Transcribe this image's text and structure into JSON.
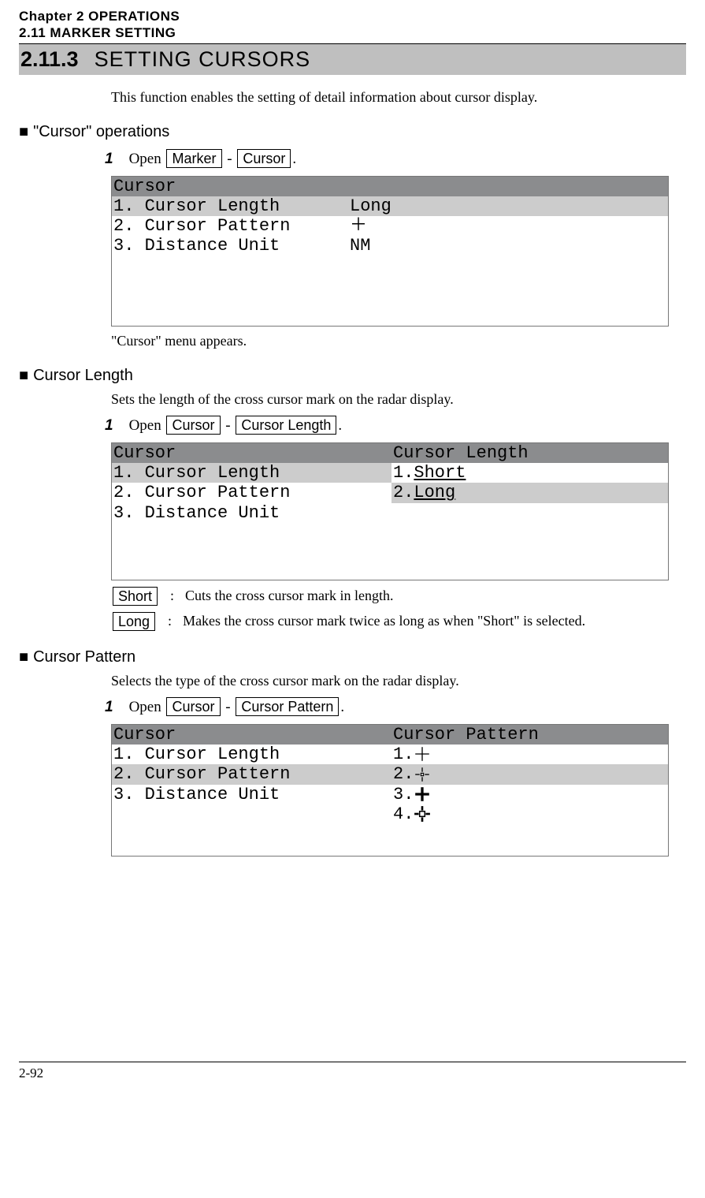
{
  "header": {
    "chapter": "Chapter  2    OPERATIONS",
    "section": "2.11    MARKER  SETTING"
  },
  "section_title": {
    "number": "2.11.3",
    "label": "SETTING CURSORS"
  },
  "intro": "This function enables the setting of detail information about cursor display.",
  "ops": {
    "heading": "\"Cursor\" operations",
    "step_open": "Open",
    "step_num": "1",
    "btn_marker": "Marker",
    "btn_cursor": "Cursor",
    "period": ".",
    "dash": " - ",
    "menu": {
      "title": "Cursor",
      "row1_label": "1.  Cursor Length",
      "row1_value": "Long",
      "row2_label": "2.  Cursor Pattern",
      "row2_value": "＋",
      "row3_label": "3.  Distance Unit",
      "row3_value": "NM"
    },
    "appears": "\"Cursor\" menu appears."
  },
  "clen": {
    "heading": "Cursor Length",
    "desc": "Sets the length of the cross cursor mark on the radar display.",
    "step_num": "1",
    "step_open": "Open",
    "btn_cursor": "Cursor",
    "btn_cursor_length": "Cursor Length",
    "period": ".",
    "dash": " - ",
    "menu": {
      "left_title": "Cursor",
      "right_title": "Cursor Length",
      "left_row1": "1.  Cursor Length",
      "left_row2": "2.  Cursor Pattern",
      "left_row3": "3.  Distance Unit",
      "right_row1_num": "1.",
      "right_row1_val": "Short",
      "right_row2_num": "2.",
      "right_row2_val": "Long"
    },
    "opt_short": "Short",
    "opt_short_desc": "Cuts the cross cursor mark in length.",
    "opt_long": "Long",
    "opt_long_desc": "Makes the cross cursor mark twice as long as when \"Short\" is selected.",
    "colon": ":"
  },
  "cpat": {
    "heading": "Cursor Pattern",
    "desc": "Selects the type of the cross cursor mark on the radar display.",
    "step_num": "1",
    "step_open": "Open",
    "btn_cursor": "Cursor",
    "btn_cursor_pattern": "Cursor Pattern",
    "period": ".",
    "dash": " - ",
    "menu": {
      "left_title": "Cursor",
      "right_title": "Cursor Pattern",
      "left_row1": "1.  Cursor Length",
      "left_row2": "2.  Cursor Pattern",
      "left_row3": "3.  Distance Unit",
      "r1": "1.",
      "r2": "2.",
      "r3": "3.",
      "r4": "4."
    }
  },
  "page_number": "2-92"
}
